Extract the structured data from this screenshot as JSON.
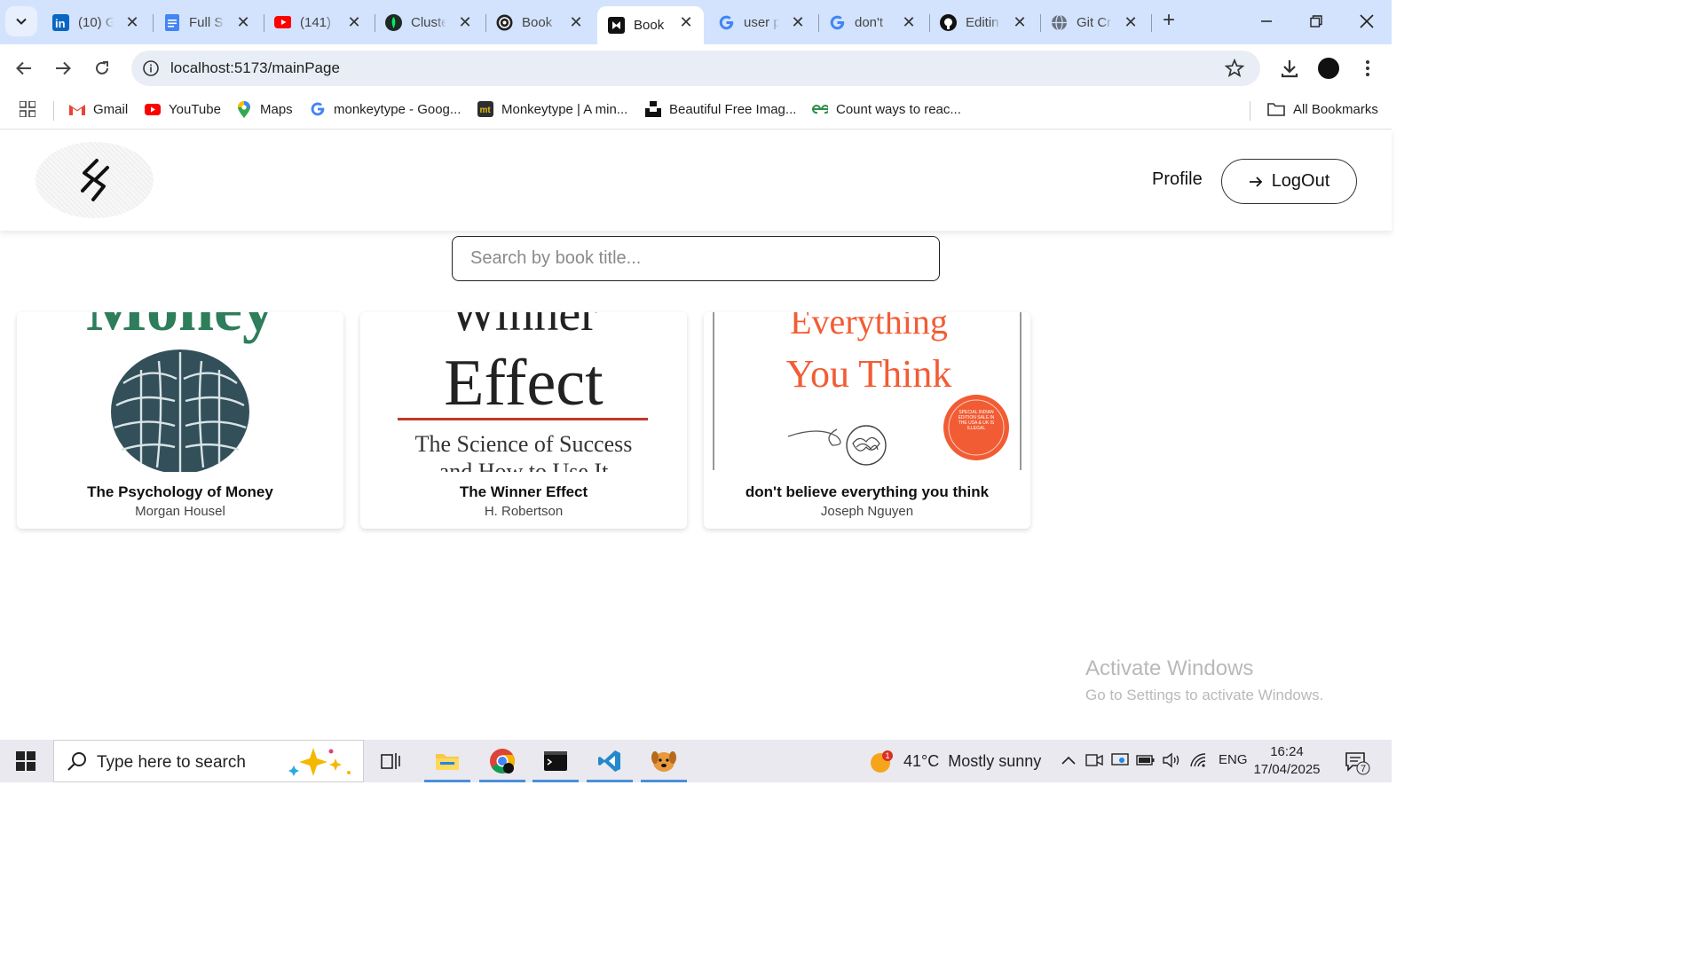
{
  "browser": {
    "tabs": [
      {
        "title": "(10) G",
        "icon": "linkedin-icon",
        "active": false
      },
      {
        "title": "Full St",
        "icon": "google-docs-icon",
        "active": false
      },
      {
        "title": "(141)",
        "icon": "youtube-icon",
        "active": false
      },
      {
        "title": "Cluste",
        "icon": "mongodb-icon",
        "active": false
      },
      {
        "title": "Book",
        "icon": "openai-icon",
        "active": false
      },
      {
        "title": "Book",
        "icon": "app-tab-icon",
        "active": true
      },
      {
        "title": "user p",
        "icon": "google-icon",
        "active": false
      },
      {
        "title": "don't",
        "icon": "google-icon",
        "active": false
      },
      {
        "title": "Editin",
        "icon": "github-icon",
        "active": false
      },
      {
        "title": "Git Cr",
        "icon": "globe-icon",
        "active": false
      }
    ],
    "url": "localhost:5173/mainPage",
    "bookmarks": [
      {
        "label": "Gmail",
        "icon": "gmail-icon"
      },
      {
        "label": "YouTube",
        "icon": "youtube-icon"
      },
      {
        "label": "Maps",
        "icon": "maps-icon"
      },
      {
        "label": "monkeytype - Goog...",
        "icon": "google-icon"
      },
      {
        "label": "Monkeytype | A min...",
        "icon": "monkeytype-icon"
      },
      {
        "label": "Beautiful Free Imag...",
        "icon": "unsplash-icon"
      },
      {
        "label": "Count ways to reac...",
        "icon": "geeksforgeeks-icon"
      }
    ],
    "all_bookmarks_label": "All Bookmarks"
  },
  "app": {
    "nav": {
      "profile_label": "Profile",
      "logout_label": "LogOut"
    },
    "search": {
      "placeholder": "Search by book title..."
    },
    "books": [
      {
        "title": "The Psychology of Money",
        "author": "Morgan Housel",
        "cover_text": "Money"
      },
      {
        "title": "The Winner Effect",
        "author": "H. Robertson",
        "cover_text_top": "Winner",
        "cover_text_main": "Effect",
        "cover_text_sub": "The Science of Success",
        "cover_text_sub2": "and How to Use It"
      },
      {
        "title": "don't believe everything you think",
        "author": "Joseph Nguyen",
        "cover_text_top": "Everything",
        "cover_text_main": "You Think",
        "badge_text": "SPECIAL INDIAN EDITION SALE IN THE USA & UK IS ILLEGAL"
      }
    ]
  },
  "watermark": {
    "title": "Activate Windows",
    "subtitle": "Go to Settings to activate Windows."
  },
  "taskbar": {
    "search_placeholder": "Type here to search",
    "weather": {
      "temp": "41°C",
      "condition": "Mostly sunny",
      "alert_count": "1"
    },
    "language": "ENG",
    "time": "16:24",
    "date": "17/04/2025",
    "notification_count": "7"
  },
  "colors": {
    "tab_strip": "#d3e3fd",
    "omnibox": "#e9eef6",
    "taskbar": "#e9e9ef",
    "cover_orange": "#f25c34",
    "cover_green": "#2e7d5b"
  }
}
